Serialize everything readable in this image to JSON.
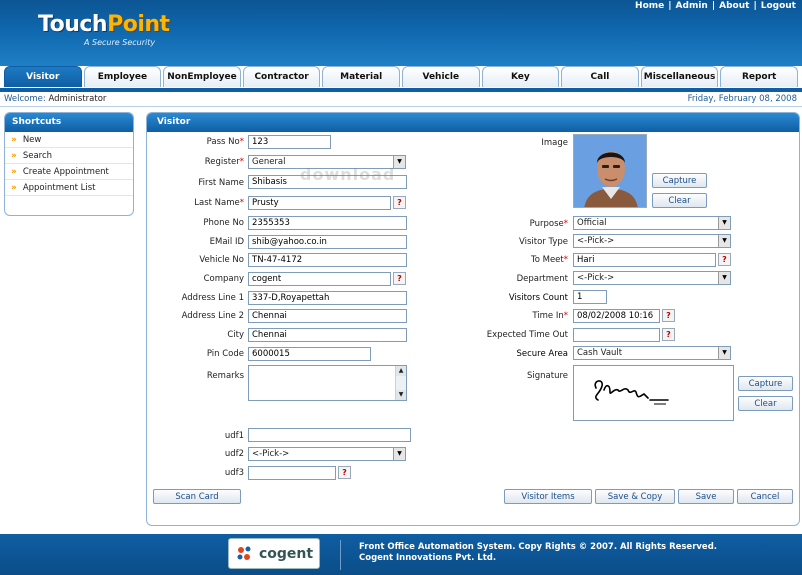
{
  "header": {
    "logo_part1": "Touch",
    "logo_part2": "Point",
    "logo_tagline": "A Secure Security",
    "links": [
      "Home",
      "Admin",
      "About",
      "Logout"
    ]
  },
  "tabs": [
    "Visitor",
    "Employee",
    "NonEmployee",
    "Contractor",
    "Material",
    "Vehicle",
    "Key",
    "Call",
    "Miscellaneous",
    "Report"
  ],
  "welcome": {
    "label": "Welcome:",
    "user": "Administrator"
  },
  "date": "Friday, February 08, 2008",
  "shortcuts": {
    "title": "Shortcuts",
    "items": [
      "New",
      "Search",
      "Create Appointment",
      "Appointment List"
    ]
  },
  "form": {
    "title": "Visitor",
    "pass_no": {
      "label": "Pass No",
      "value": "123"
    },
    "register": {
      "label": "Register",
      "value": "General"
    },
    "first_name": {
      "label": "First Name",
      "value": "Shibasis"
    },
    "last_name": {
      "label": "Last Name",
      "value": "Prusty"
    },
    "phone_no": {
      "label": "Phone No",
      "value": "2355353"
    },
    "email": {
      "label": "EMail ID",
      "value": "shib@yahoo.co.in"
    },
    "vehicle_no": {
      "label": "Vehicle No",
      "value": "TN-47-4172"
    },
    "company": {
      "label": "Company",
      "value": "cogent"
    },
    "address1": {
      "label": "Address Line 1",
      "value": "337-D,Royapettah"
    },
    "address2": {
      "label": "Address Line 2",
      "value": "Chennai"
    },
    "city": {
      "label": "City",
      "value": "Chennai"
    },
    "pin_code": {
      "label": "Pin Code",
      "value": "6000015"
    },
    "remarks": {
      "label": "Remarks",
      "value": ""
    },
    "udf1": {
      "label": "udf1",
      "value": ""
    },
    "udf2": {
      "label": "udf2",
      "value": "<-Pick->"
    },
    "udf3": {
      "label": "udf3",
      "value": ""
    },
    "image": {
      "label": "Image"
    },
    "capture_label": "Capture",
    "clear_label": "Clear",
    "purpose": {
      "label": "Purpose",
      "value": "Official"
    },
    "visitor_type": {
      "label": "Visitor Type",
      "value": "<-Pick->"
    },
    "to_meet": {
      "label": "To Meet",
      "value": "Hari"
    },
    "department": {
      "label": "Department",
      "value": "<-Pick->"
    },
    "visitors_count": {
      "label": "Visitors Count",
      "value": "1"
    },
    "time_in": {
      "label": "Time In",
      "value": "08/02/2008 10:16"
    },
    "expected_time_out": {
      "label": "Expected Time Out",
      "value": ""
    },
    "secure_area": {
      "label": "Secure Area",
      "value": "Cash Vault"
    },
    "signature": {
      "label": "Signature"
    },
    "buttons": {
      "scan_card": "Scan Card",
      "visitor_items": "Visitor Items",
      "save_copy": "Save & Copy",
      "save": "Save",
      "cancel": "Cancel"
    }
  },
  "watermark": "download",
  "footer": {
    "logo_text": "cogent",
    "line1": "Front Office Automation System. Copy Rights © 2007. All Rights Reserved.",
    "line2": "Cogent Innovations Pvt. Ltd."
  },
  "colors": {
    "brand_blue": "#0f5ea3",
    "required_red": "#d40000",
    "accent_orange": "#f09a00"
  }
}
